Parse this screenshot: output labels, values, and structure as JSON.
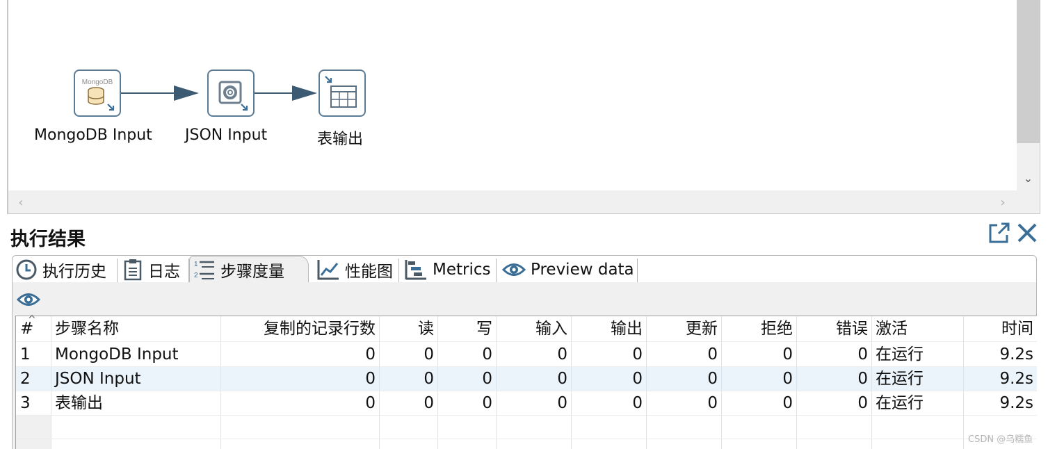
{
  "canvas": {
    "steps": [
      {
        "id": "mongodb",
        "label": "MongoDB Input",
        "icon": "mongodb-input-icon",
        "icon_caption": "MongoDB"
      },
      {
        "id": "json",
        "label": "JSON Input",
        "icon": "json-input-icon"
      },
      {
        "id": "table",
        "label": "表输出",
        "icon": "table-output-icon"
      }
    ]
  },
  "panel": {
    "title": "执行结果",
    "tabs": [
      {
        "label": "执行历史",
        "icon": "clock-icon"
      },
      {
        "label": "日志",
        "icon": "log-icon"
      },
      {
        "label": "步骤度量",
        "icon": "step-metrics-icon",
        "active": true
      },
      {
        "label": "性能图",
        "icon": "line-chart-icon"
      },
      {
        "label": "Metrics",
        "icon": "metrics-icon"
      },
      {
        "label": "Preview data",
        "icon": "eye-icon"
      }
    ]
  },
  "grid": {
    "headers": [
      "#",
      "步骤名称",
      "复制的记录行数",
      "读",
      "写",
      "输入",
      "输出",
      "更新",
      "拒绝",
      "错误",
      "激活",
      "时间"
    ],
    "rows": [
      [
        "1",
        "MongoDB Input",
        "0",
        "0",
        "0",
        "0",
        "0",
        "0",
        "0",
        "0",
        "在运行",
        "9.2s"
      ],
      [
        "2",
        "JSON Input",
        "0",
        "0",
        "0",
        "0",
        "0",
        "0",
        "0",
        "0",
        "在运行",
        "9.2s"
      ],
      [
        "3",
        "表输出",
        "0",
        "0",
        "0",
        "0",
        "0",
        "0",
        "0",
        "0",
        "在运行",
        "9.2s"
      ]
    ]
  },
  "watermark": "CSDN @乌糯鱼",
  "colors": {
    "accent": "#3a6e96",
    "node_border": "#5b7a94",
    "hop_line": "#3d5a73",
    "highlight_row": "#ecf4fb"
  }
}
